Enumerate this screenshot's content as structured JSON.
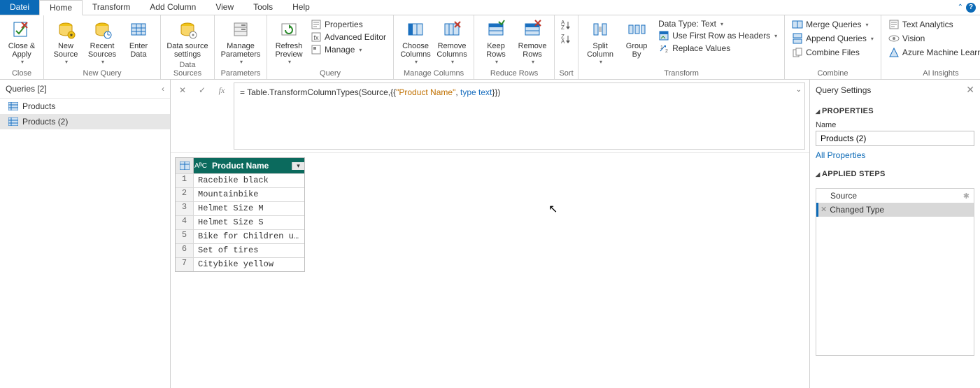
{
  "tabs": {
    "datei": "Datei",
    "home": "Home",
    "transform": "Transform",
    "addcol": "Add Column",
    "view": "View",
    "tools": "Tools",
    "help": "Help"
  },
  "ribbon": {
    "close": {
      "close_apply": "Close &\nApply",
      "group": "Close"
    },
    "newquery": {
      "new_source": "New\nSource",
      "recent_sources": "Recent\nSources",
      "enter_data": "Enter\nData",
      "group": "New Query"
    },
    "datasources": {
      "settings": "Data source\nsettings",
      "group": "Data Sources"
    },
    "parameters": {
      "manage": "Manage\nParameters",
      "group": "Parameters"
    },
    "query": {
      "refresh": "Refresh\nPreview",
      "properties": "Properties",
      "adv": "Advanced Editor",
      "manage": "Manage",
      "group": "Query"
    },
    "managecols": {
      "choose": "Choose\nColumns",
      "remove": "Remove\nColumns",
      "group": "Manage Columns"
    },
    "reducerows": {
      "keep": "Keep\nRows",
      "remove": "Remove\nRows",
      "group": "Reduce Rows"
    },
    "sort": {
      "group": "Sort"
    },
    "transform": {
      "split": "Split\nColumn",
      "groupby": "Group\nBy",
      "datatype": "Data Type: Text",
      "firstrow": "Use First Row as Headers",
      "replace": "Replace Values",
      "group": "Transform"
    },
    "combine": {
      "merge": "Merge Queries",
      "append": "Append Queries",
      "combine": "Combine Files",
      "group": "Combine"
    },
    "ai": {
      "text": "Text Analytics",
      "vision": "Vision",
      "aml": "Azure Machine Learning",
      "group": "AI Insights"
    }
  },
  "queries": {
    "title": "Queries [2]",
    "items": [
      "Products",
      "Products (2)"
    ]
  },
  "formula": {
    "prefix": "= Table.TransformColumnTypes(Source,{{",
    "str": "\"Product Name\"",
    "sep": ", ",
    "kw1": "type ",
    "kw2": "text",
    "suffix": "}})"
  },
  "grid": {
    "col_type": "AᴮC",
    "col_name": "Product Name",
    "rows": [
      "Racebike black",
      "Mountainbike",
      "Helmet Size M",
      "Helmet Size S",
      "Bike for Children up…",
      "Set of tires",
      "Citybike yellow"
    ]
  },
  "settings": {
    "title": "Query Settings",
    "properties": "PROPERTIES",
    "name_label": "Name",
    "name_value": "Products (2)",
    "all_props": "All Properties",
    "applied": "APPLIED STEPS",
    "steps": [
      "Source",
      "Changed Type"
    ]
  }
}
